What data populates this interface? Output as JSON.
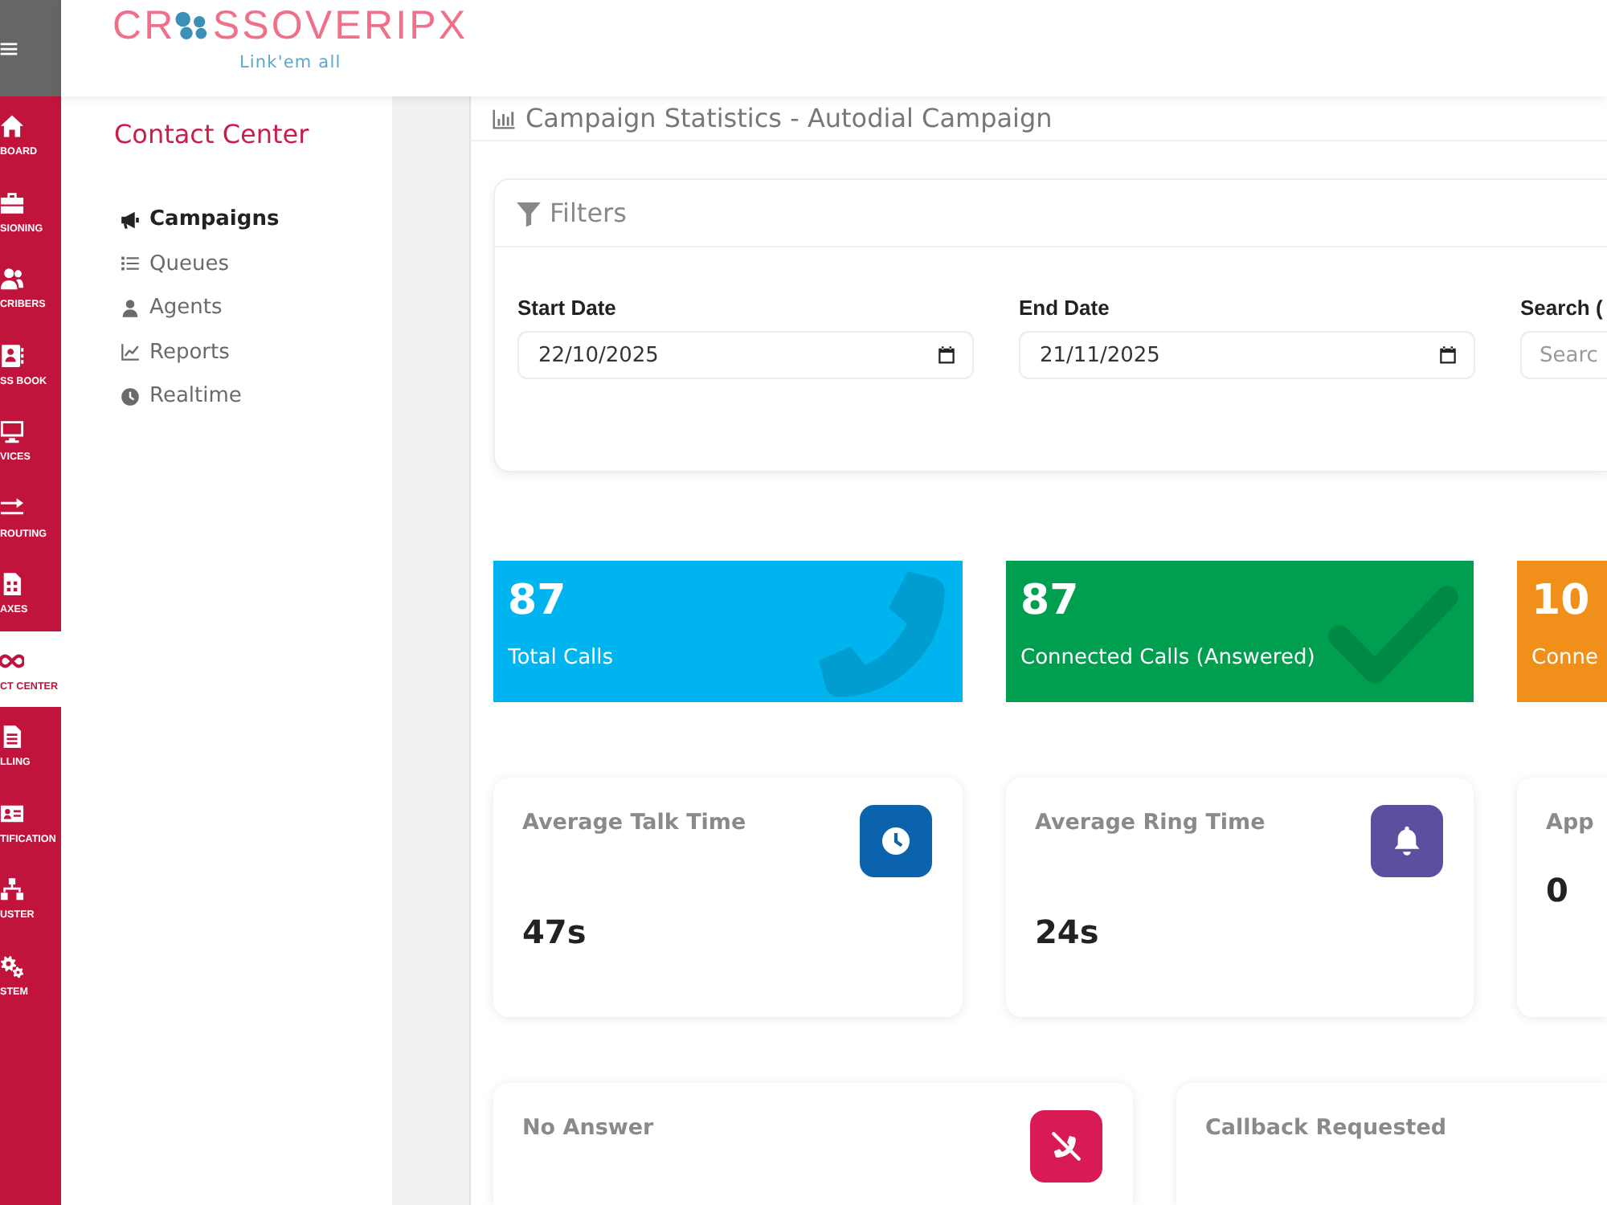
{
  "header": {
    "logo": {
      "before": "CR",
      "after": "SSOVERIPX",
      "tagline": "Link'em all"
    }
  },
  "rail": [
    {
      "label": "BOARD",
      "selected": false
    },
    {
      "label": "SIONING",
      "selected": false
    },
    {
      "label": "CRIBERS",
      "selected": false
    },
    {
      "label": "SS BOOK",
      "selected": false
    },
    {
      "label": "VICES",
      "selected": false
    },
    {
      "label": "ROUTING",
      "selected": false
    },
    {
      "label": "AXES",
      "selected": false
    },
    {
      "label": "CT CENTER",
      "selected": true
    },
    {
      "label": "LLING",
      "selected": false
    },
    {
      "label": "TIFICATION",
      "selected": false
    },
    {
      "label": "USTER",
      "selected": false
    },
    {
      "label": "STEM",
      "selected": false
    }
  ],
  "submenu": {
    "title": "Contact Center",
    "items": [
      {
        "label": "Campaigns",
        "selected": true
      },
      {
        "label": "Queues",
        "selected": false
      },
      {
        "label": "Agents",
        "selected": false
      },
      {
        "label": "Reports",
        "selected": false
      },
      {
        "label": "Realtime",
        "selected": false
      }
    ]
  },
  "page": {
    "title": "Campaign Statistics - Autodial Campaign"
  },
  "filters": {
    "title": "Filters",
    "fields": [
      {
        "kind": "date",
        "label": "Start Date",
        "value": "22/10/2025"
      },
      {
        "kind": "date",
        "label": "End Date",
        "value": "21/11/2025"
      },
      {
        "kind": "text",
        "label": "Search (",
        "placeholder": "Searc"
      }
    ]
  },
  "summary_tiles": [
    {
      "value": "87",
      "label": "Total Calls",
      "color": "#00b5ef"
    },
    {
      "value": "87",
      "label": "Connected Calls (Answered)",
      "color": "#009e4f"
    },
    {
      "value": "10",
      "label": "Conne",
      "color": "#f0901a"
    }
  ],
  "metric_cards": [
    {
      "title": "Average Talk Time",
      "value": "47s",
      "color": "#0b62ad"
    },
    {
      "title": "Average Ring Time",
      "value": "24s",
      "color": "#5b4f9f"
    },
    {
      "title": "App",
      "value": "0"
    }
  ],
  "outcome_cards": [
    {
      "title": "No Answer",
      "color": "#d81b55"
    },
    {
      "title": "Callback Requested"
    }
  ]
}
